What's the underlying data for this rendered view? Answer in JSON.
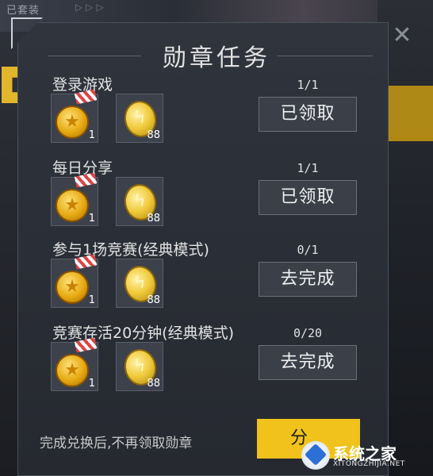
{
  "background": {
    "top_text": "已套装",
    "top_arrows": "▷▷▷"
  },
  "dialog": {
    "title": "勋章任务",
    "close_icon": "close-icon",
    "tasks": [
      {
        "name": "登录游戏",
        "medal_qty": "1",
        "coin_qty": "88",
        "progress": "1/1",
        "button_label": "已领取"
      },
      {
        "name": "每日分享",
        "medal_qty": "1",
        "coin_qty": "88",
        "progress": "1/1",
        "button_label": "已领取"
      },
      {
        "name": "参与1场竞赛(经典模式)",
        "medal_qty": "1",
        "coin_qty": "88",
        "progress": "0/1",
        "button_label": "去完成"
      },
      {
        "name": "竞赛存活20分钟(经典模式)",
        "medal_qty": "1",
        "coin_qty": "88",
        "progress": "0/20",
        "button_label": "去完成"
      }
    ],
    "footer_text": "完成兑换后,不再领取勋章",
    "bottom_button_label": "分"
  },
  "watermark": {
    "text": "系统之家",
    "sub": "XITONGZHIJIA.NET"
  },
  "colors": {
    "accent": "#f1c21b",
    "panel": "#2a2e36",
    "button": "#3a3f48"
  }
}
